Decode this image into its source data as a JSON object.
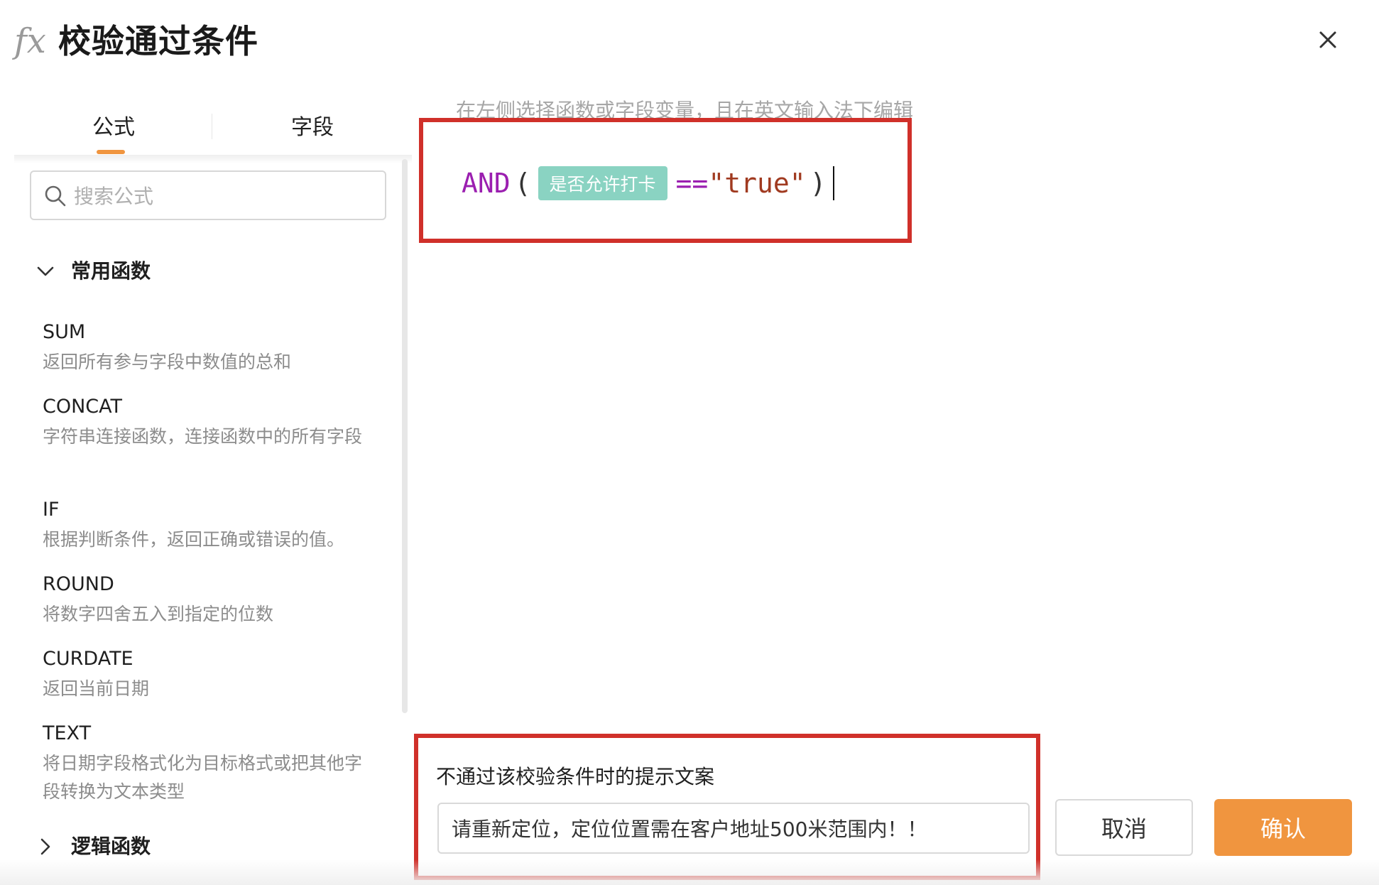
{
  "header": {
    "icon": "fx-icon",
    "title": "校验通过条件",
    "close_icon": "close-icon"
  },
  "tabs": [
    {
      "label": "公式",
      "active": true
    },
    {
      "label": "字段",
      "active": false
    }
  ],
  "search": {
    "placeholder": "搜索公式",
    "value": ""
  },
  "groups": {
    "common": {
      "label": "常用函数",
      "expanded": true
    },
    "logic": {
      "label": "逻辑函数",
      "expanded": false
    }
  },
  "functions": [
    {
      "name": "SUM",
      "desc": "返回所有参与字段中数值的总和"
    },
    {
      "name": "CONCAT",
      "desc": "字符串连接函数，连接函数中的所有字段"
    },
    {
      "name": "IF",
      "desc": "根据判断条件，返回正确或错误的值。"
    },
    {
      "name": "ROUND",
      "desc": "将数字四舍五入到指定的位数"
    },
    {
      "name": "CURDATE",
      "desc": "返回当前日期"
    },
    {
      "name": "TEXT",
      "desc": "将日期字段格式化为目标格式或把其他字段转换为文本类型"
    }
  ],
  "editor": {
    "hint": "在左侧选择函数或字段变量，且在英文输入法下编辑",
    "formula": {
      "func": "AND",
      "open_paren": "(",
      "field_chip": "是否允许打卡",
      "operator": "==",
      "string_value": "\"true\"",
      "close_paren": ")"
    }
  },
  "failure_message": {
    "label": "不通过该校验条件时的提示文案",
    "value": "请重新定位，定位位置需在客户地址500米范围内！！"
  },
  "buttons": {
    "cancel": "取消",
    "confirm": "确认"
  },
  "colors": {
    "accent": "#f0953f",
    "highlight_border": "#d0302a",
    "field_chip": "#8ad3c2",
    "function_keyword": "#9b1fb0",
    "string_literal": "#a03a20"
  }
}
